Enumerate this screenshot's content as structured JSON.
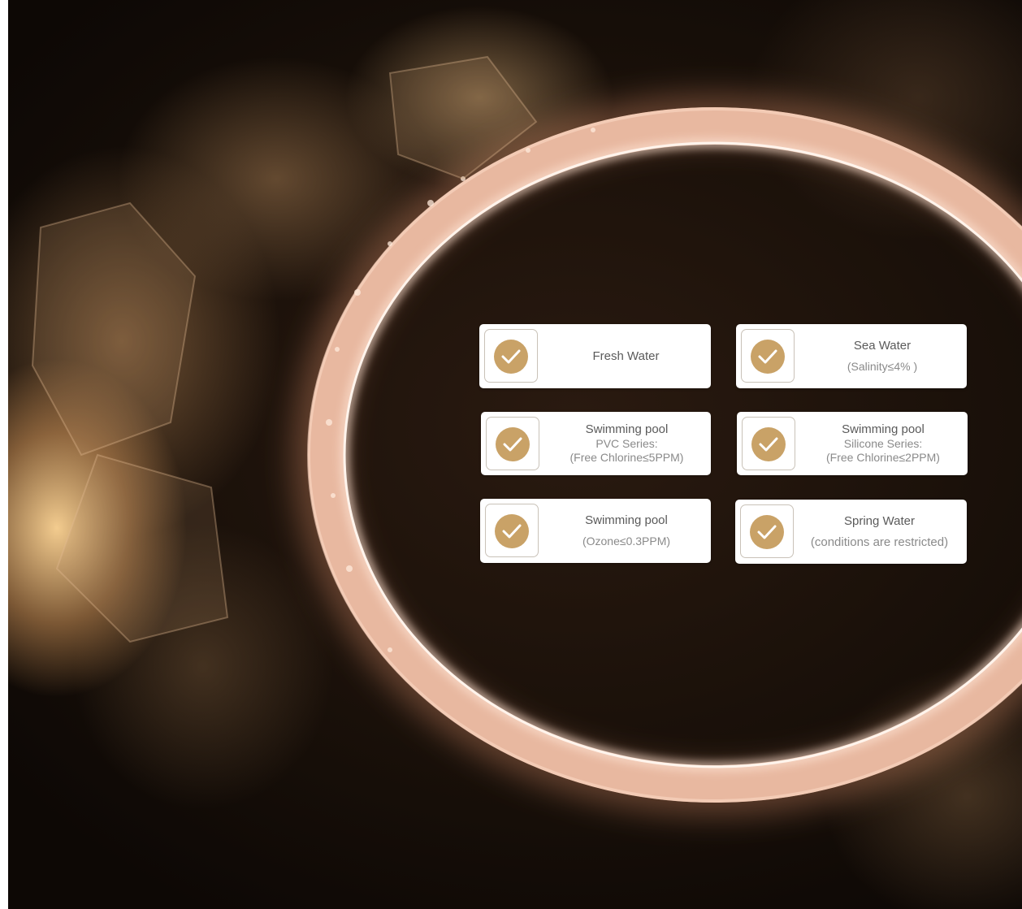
{
  "colors": {
    "accent": "#c9a267",
    "card_background": "#ffffff",
    "text_primary": "#5a5a5a",
    "text_secondary": "#8a8a8a"
  },
  "icon": "checkmark-circle-icon",
  "cards": [
    {
      "title": "Fresh Water",
      "lines": []
    },
    {
      "title": "Sea Water",
      "lines": [
        "(Salinity≤4% )"
      ]
    },
    {
      "title": "Swimming pool",
      "lines": [
        "PVC Series:",
        "(Free Chlorine≤5PPM)"
      ]
    },
    {
      "title": "Swimming pool",
      "lines": [
        "Silicone Series:",
        "(Free Chlorine≤2PPM)"
      ]
    },
    {
      "title": "Swimming pool",
      "lines": [
        "(Ozone≤0.3PPM)"
      ]
    },
    {
      "title": "Spring Water",
      "lines": [
        "(conditions are restricted)"
      ]
    }
  ]
}
